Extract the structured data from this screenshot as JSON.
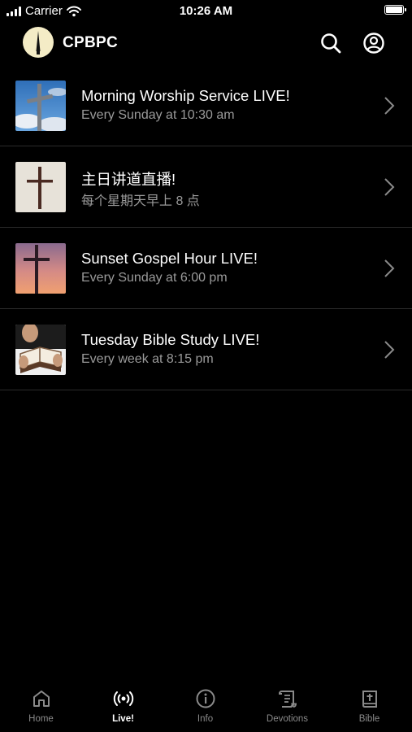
{
  "status_bar": {
    "carrier": "Carrier",
    "time": "10:26 AM"
  },
  "header": {
    "title": "CPBPC"
  },
  "live_list": [
    {
      "title": "Morning Worship Service LIVE!",
      "subtitle": "Every Sunday at 10:30 am"
    },
    {
      "title": "主日讲道直播!",
      "subtitle": "每个星期天早上 8 点"
    },
    {
      "title": "Sunset Gospel Hour LIVE!",
      "subtitle": "Every Sunday at 6:00 pm"
    },
    {
      "title": "Tuesday Bible Study LIVE!",
      "subtitle": "Every week at 8:15 pm"
    }
  ],
  "tab_bar": {
    "tabs": [
      {
        "label": "Home",
        "icon": "home-icon",
        "active": false
      },
      {
        "label": "Live!",
        "icon": "broadcast-icon",
        "active": true
      },
      {
        "label": "Info",
        "icon": "info-icon",
        "active": false
      },
      {
        "label": "Devotions",
        "icon": "scroll-icon",
        "active": false
      },
      {
        "label": "Bible",
        "icon": "bible-icon",
        "active": false
      }
    ]
  },
  "colors": {
    "background": "#000000",
    "text_primary": "#ffffff",
    "text_secondary": "#9a9a9a",
    "divider": "#2a2a2a",
    "logo_background": "#f4ecc6"
  }
}
